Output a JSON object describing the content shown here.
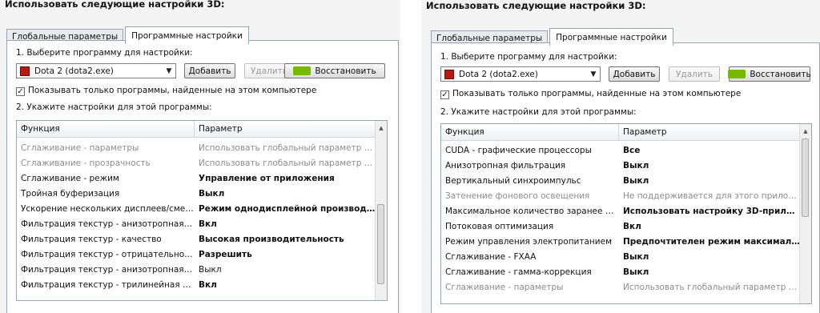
{
  "left": {
    "header": "Использовать следующие настройки 3D:",
    "tabs": [
      {
        "label": "Глобальные параметры",
        "active": false
      },
      {
        "label": "Программные настройки",
        "active": true
      }
    ],
    "step1_label": "1. Выберите программу для настройки:",
    "program_select": "Dota 2 (dota2.exe)",
    "buttons": {
      "add": "Добавить",
      "remove": "Удалить",
      "restore": "Восстановить"
    },
    "checkbox_label": "Показывать только программы, найденные на этом компьютере",
    "checkbox_checked": true,
    "step2_label": "2. Укажите настройки для этой программы:",
    "table": {
      "headers": [
        "Функция",
        "Параметр"
      ],
      "rows": [
        {
          "feature": "Сглаживание - параметры",
          "value": "Использовать глобальный параметр (Нет)",
          "gray": true,
          "bold": false
        },
        {
          "feature": "Сглаживание - прозрачность",
          "value": "Использовать глобальный параметр (В...",
          "gray": true,
          "bold": false
        },
        {
          "feature": "Сглаживание - режим",
          "value": "Управление от приложения",
          "gray": false,
          "bold": true
        },
        {
          "feature": "Тройная буферизация",
          "value": "Выкл",
          "gray": false,
          "bold": true
        },
        {
          "feature": "Ускорение нескольких дисплеев/смеша...",
          "value": "Режим однодисплейной производи...",
          "gray": false,
          "bold": true
        },
        {
          "feature": "Фильтрация текстур - анизотропная оп...",
          "value": "Вкл",
          "gray": false,
          "bold": true
        },
        {
          "feature": "Фильтрация текстур - качество",
          "value": "Высокая производительность",
          "gray": false,
          "bold": true
        },
        {
          "feature": "Фильтрация текстур - отрицательное о...",
          "value": "Разрешить",
          "gray": false,
          "bold": true
        },
        {
          "feature": "Фильтрация текстур - анизотропная оп...",
          "value": "Выкл",
          "gray": false,
          "bold": false
        },
        {
          "feature": "Фильтрация текстур - трилинейная опт...",
          "value": "Вкл",
          "gray": false,
          "bold": true
        }
      ]
    }
  },
  "right": {
    "header": "Использовать следующие настройки 3D:",
    "tabs": [
      {
        "label": "Глобальные параметры",
        "active": false
      },
      {
        "label": "Программные настройки",
        "active": true
      }
    ],
    "step1_label": "1. Выберите программу для настройки:",
    "program_select": "Dota 2 (dota2.exe)",
    "buttons": {
      "add": "Добавить",
      "remove": "Удалить",
      "restore": "Восстановить"
    },
    "checkbox_label": "Показывать только программы, найденные на этом компьютере",
    "checkbox_checked": true,
    "step2_label": "2. Укажите настройки для этой программы:",
    "table": {
      "headers": [
        "Функция",
        "Параметр"
      ],
      "rows": [
        {
          "feature": "CUDA - графические процессоры",
          "value": "Все",
          "gray": false,
          "bold": true
        },
        {
          "feature": "Анизотропная фильтрация",
          "value": "Выкл",
          "gray": false,
          "bold": true
        },
        {
          "feature": "Вертикальный синхроимпульс",
          "value": "Выкл",
          "gray": false,
          "bold": true
        },
        {
          "feature": "Затенение фонового освещения",
          "value": "Не поддерживается для этого приложе...",
          "gray": true,
          "bold": false
        },
        {
          "feature": "Максимальное количество заранее под...",
          "value": "Использовать настройку 3D-прило...",
          "gray": false,
          "bold": true
        },
        {
          "feature": "Потоковая оптимизация",
          "value": "Вкл",
          "gray": false,
          "bold": true
        },
        {
          "feature": "Режим управления электропитанием",
          "value": "Предпочтителен режим максимал...",
          "gray": false,
          "bold": true
        },
        {
          "feature": "Сглаживание - FXAA",
          "value": "Выкл",
          "gray": false,
          "bold": true
        },
        {
          "feature": "Сглаживание - гамма-коррекция",
          "value": "Выкл",
          "gray": false,
          "bold": true
        },
        {
          "feature": "Сглаживание - параметры",
          "value": "Использовать глобальный параметр (Нет)",
          "gray": true,
          "bold": false
        }
      ]
    }
  },
  "colors": {
    "nvidia_green": "#76b900",
    "dota_icon": "#b81a12",
    "disabled_text": "#8c8c8c"
  },
  "icons": {
    "program": "dota2-icon",
    "restore": "nvidia-logo-icon",
    "dropdown": "chevron-down-icon",
    "check": "checkmark-icon"
  }
}
